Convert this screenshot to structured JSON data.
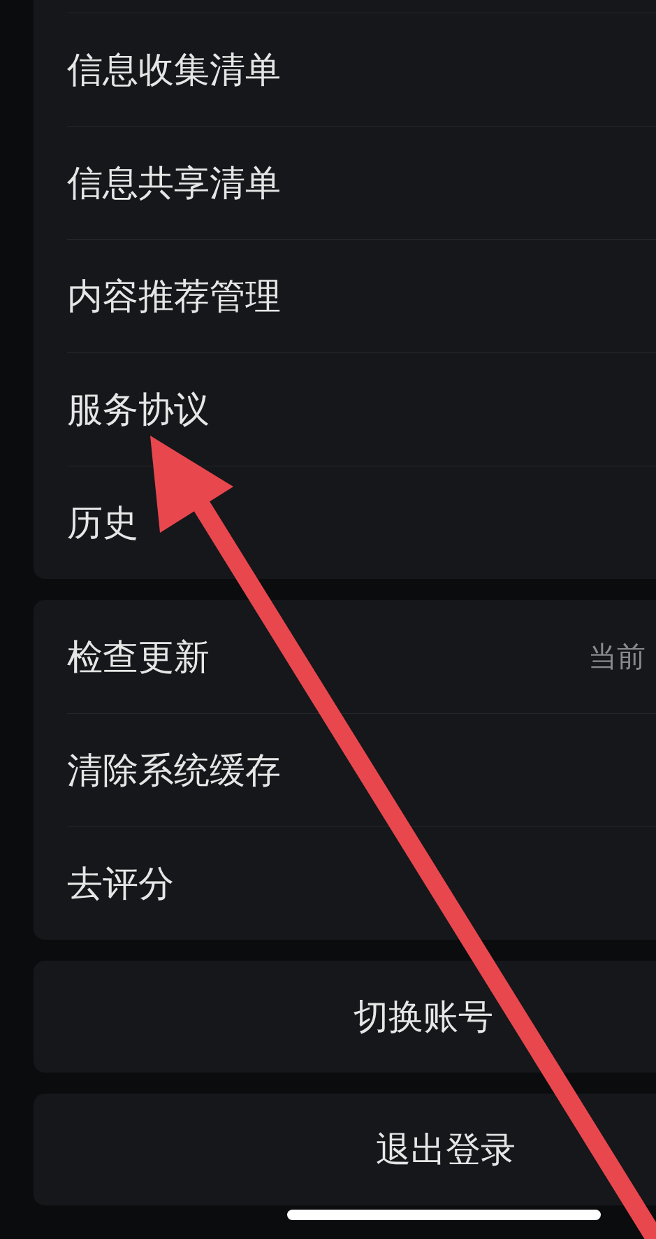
{
  "groups": [
    {
      "items": [
        {
          "label": "信息收集清单"
        },
        {
          "label": "信息共享清单"
        },
        {
          "label": "内容推荐管理"
        },
        {
          "label": "服务协议"
        },
        {
          "label": "历史"
        }
      ]
    },
    {
      "items": [
        {
          "label": "检查更新",
          "value": "当前"
        },
        {
          "label": "清除系统缓存"
        },
        {
          "label": "去评分"
        }
      ]
    }
  ],
  "actions": [
    {
      "label": "切换账号"
    },
    {
      "label": "退出登录"
    }
  ],
  "annotation": {
    "kind": "arrow"
  }
}
